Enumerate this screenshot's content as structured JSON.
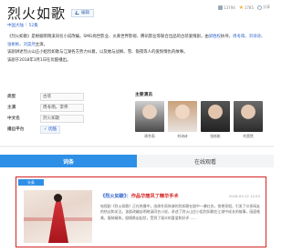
{
  "header": {
    "title": "烈火如歌",
    "edit_label": "编辑",
    "category": "中国大陆",
    "episodes": "52集"
  },
  "stats": {
    "likes": "13794",
    "stars": "1785",
    "share": "分享"
  },
  "intro": {
    "p1_a": "《烈火如歌》是根据明晓溪同名小说改编，SMG尚世影业、炎黄世界影视、腾讯影业等联合出品的古装爱情剧，由",
    "p1_link1": "梁胜权",
    "p1_b": "执导，",
    "p1_link2": "周冬雨",
    "p1_c": "、",
    "p1_link3": "刘诗诗",
    "p1_d": "、",
    "p1_link4": "张彬彬",
    "p1_e": "、",
    "p1_link5": "刘昊然",
    "p1_f": "主演。",
    "p2": "该剧讲述烈火山庄小姐烈如歌与江湖各方势力纠葛，以及她与战枫、雪、银夜等人的爱恨情仇的故事。",
    "p3": "该剧于2018年3月1日在优酷播出。"
  },
  "info": {
    "type_label": "类型",
    "type_value": "古装",
    "starring_label": "主演",
    "starring_value": "周冬雨，李伟",
    "cn_name_label": "中文名",
    "cn_name_value": "烈火如歌",
    "platform_label": "播出平台",
    "platform_value": "优酷"
  },
  "cast": {
    "title": "主要演员",
    "members": [
      {
        "name": "周冬雨"
      },
      {
        "name": "刘诗诗"
      },
      {
        "name": "张彬彬"
      },
      {
        "name": "刘昊然"
      }
    ]
  },
  "tabs": [
    {
      "label": "词条"
    },
    {
      "label": "在线观看"
    }
  ],
  "news": {
    "tag": "头条",
    "title_prefix": "《烈火如歌》：",
    "title_highlight": "作品华丽风了精华手术",
    "title_suffix": "",
    "date": "2018-03-12 12:52",
    "summary": "电视剧《烈火如歌》正在热播中，由周冬雨饰演的烈如歌在剧中一袭红衣，惊艳亮相，引发了众多网友的热议和关注。该剧改编自明晓溪同名小说，讲述了烈火山庄小姐烈如歌在江湖中成长的故事，画面唯美，服装精致，剧情跌宕起伏，受到了观众的喜爱和好评……"
  }
}
